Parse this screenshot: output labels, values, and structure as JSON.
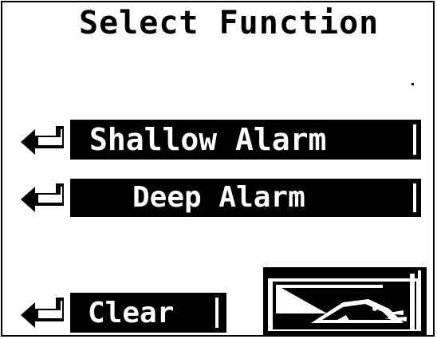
{
  "screen": {
    "title": "Select Function",
    "menu": [
      {
        "id": "shallow-alarm",
        "label": "Shallow  Alarm"
      },
      {
        "id": "deep-alarm",
        "label": "Deep Alarm"
      },
      {
        "id": "clear",
        "label": "Clear"
      }
    ],
    "fish_button": {
      "icon": "fish-icon"
    }
  },
  "colors": {
    "foreground": "#000000",
    "background": "#ffffff"
  }
}
